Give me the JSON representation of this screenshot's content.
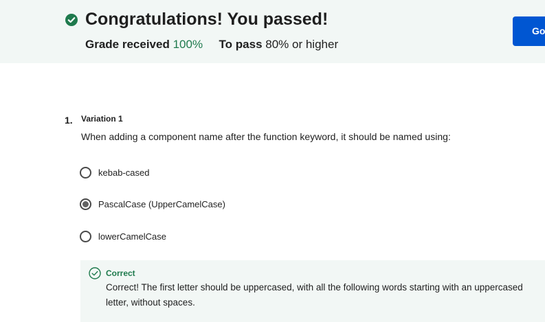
{
  "banner": {
    "title": "Congratulations! You passed!",
    "grade_label": "Grade received",
    "grade_value": "100%",
    "pass_label": "To pass",
    "pass_value": "80% or higher",
    "go_button_label": "Go"
  },
  "question": {
    "number": "1.",
    "title": "Variation 1",
    "text": "When adding a component name after the function keyword, it should be named using:",
    "options": [
      {
        "label": "kebab-cased",
        "selected": false
      },
      {
        "label": "PascalCase (UpperCamelCase)",
        "selected": true
      },
      {
        "label": "lowerCamelCase",
        "selected": false
      }
    ]
  },
  "feedback": {
    "status": "Correct",
    "text": "Correct! The first letter should be uppercased, with all the following words starting with an uppercased letter, without spaces."
  },
  "colors": {
    "success_green": "#1f7a4d",
    "banner_bg": "#f2f7f5",
    "primary_blue": "#0056d2"
  },
  "icons": {
    "banner": "check-circle-filled-icon",
    "feedback": "check-circle-outline-icon"
  }
}
